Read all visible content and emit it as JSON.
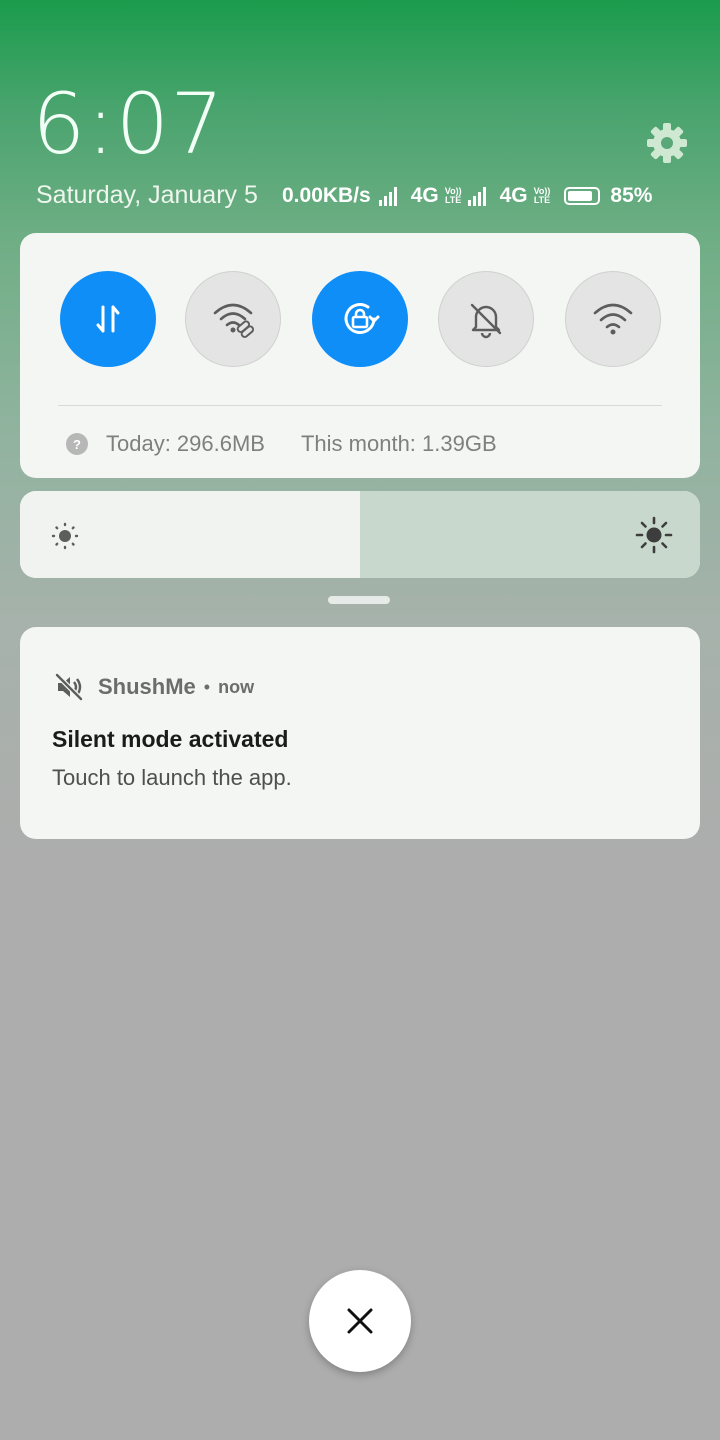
{
  "header": {
    "time": "6:07",
    "date": "Saturday, January 5"
  },
  "status_bar": {
    "net_speed": "0.00KB/s",
    "sim1_type": "4G",
    "sim2_type": "4G",
    "volte_top": "Vo))",
    "volte_bottom": "LTE",
    "battery_percent": "85%",
    "battery_level": 0.85
  },
  "quick_toggles": [
    {
      "name": "mobile-data",
      "icon": "data-arrows-icon",
      "state": "on"
    },
    {
      "name": "wifi-hotspot",
      "icon": "hotspot-icon",
      "state": "off"
    },
    {
      "name": "rotation-lock",
      "icon": "rotation-lock-icon",
      "state": "on"
    },
    {
      "name": "silent",
      "icon": "bell-off-icon",
      "state": "off"
    },
    {
      "name": "wifi",
      "icon": "wifi-icon",
      "state": "off"
    }
  ],
  "data_usage": {
    "today": "Today: 296.6MB",
    "month": "This month: 1.39GB",
    "help_glyph": "?"
  },
  "brightness": {
    "level": 0.5
  },
  "notification": {
    "app": "ShushMe",
    "separator": "•",
    "time": "now",
    "title": "Silent mode activated",
    "body": "Touch to launch the app."
  },
  "colors": {
    "toggle_on": "#0f8ef8",
    "toggle_off": "#e3e4e3",
    "gradient_top": "#1a9c4c",
    "background": "#adadad"
  }
}
